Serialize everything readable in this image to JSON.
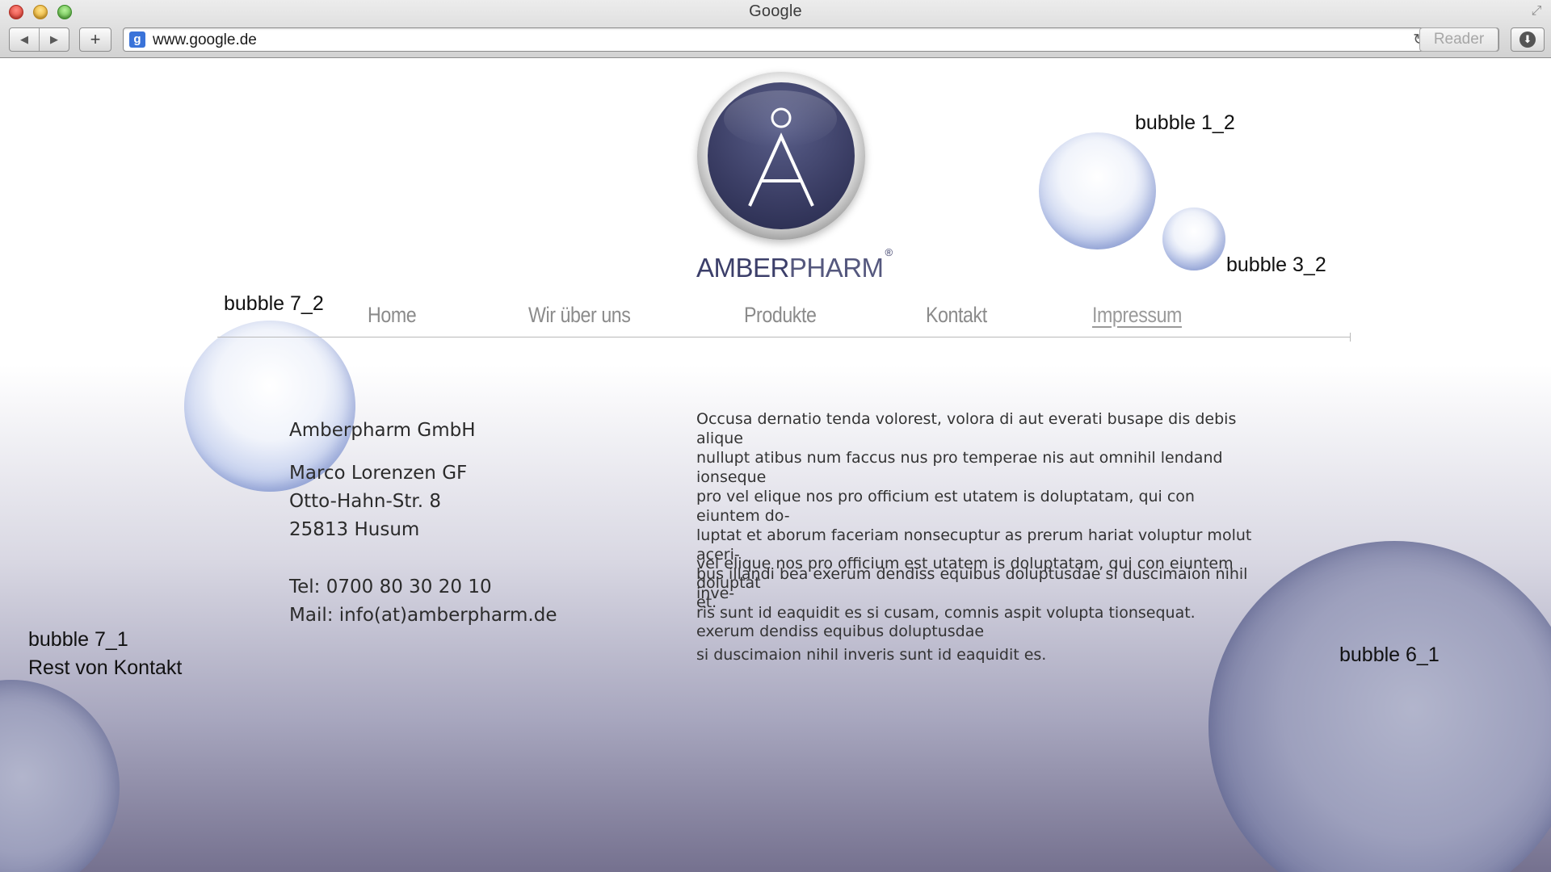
{
  "browser": {
    "window_title": "Google",
    "url": "www.google.de",
    "favicon_letter": "g",
    "reader_label": "Reader"
  },
  "logo": {
    "letter": "Å",
    "brand_bold": "AMBER",
    "brand_light": "PHARM",
    "registered": "®"
  },
  "nav": {
    "items": [
      {
        "label": "Home"
      },
      {
        "label": "Wir über uns"
      },
      {
        "label": "Produkte"
      },
      {
        "label": "Kontakt"
      },
      {
        "label": "Impressum",
        "active": true
      }
    ]
  },
  "annotations": {
    "bubble_1_2": "bubble 1_2",
    "bubble_3_2": "bubble 3_2",
    "bubble_7_2": "bubble 7_2",
    "bubble_7_1": "bubble 7_1",
    "rest_von_kontakt": "Rest von Kontakt",
    "bubble_6_1": "bubble 6_1"
  },
  "contact": {
    "company": "Amberpharm GmbH",
    "person": "Marco Lorenzen GF",
    "street": "Otto-Hahn-Str. 8",
    "city": "25813 Husum",
    "tel": "Tel: 0700 80 30 20 10",
    "mail": "Mail:  info(at)amberpharm.de"
  },
  "content": {
    "paragraph1": [
      "Occusa dernatio tenda volorest, volora di aut everati busape dis debis alique",
      "nullupt atibus num faccus nus pro temperae nis aut omnihil lendand ionseque",
      "pro vel elique nos pro officium est utatem is doluptatam, qui con eiuntem do-",
      "luptat et aborum faceriam nonsecuptur as prerum hariat voluptur molut aceri-",
      "bus illandi bea exerum dendiss equibus doluptusdae si duscimaion nihil inve-",
      "ris sunt id eaquidit es si cusam, comnis aspit volupta tionsequat."
    ],
    "paragraph2": [
      "vel elique nos pro officium est utatem is doluptatam, qui con eiuntem doluptat",
      "et."
    ],
    "paragraph3": [
      "exerum dendiss equibus doluptusdae",
      "si duscimaion nihil inveris sunt id eaquidit es."
    ]
  },
  "colors": {
    "brand": "#3c3f6a",
    "nav_text": "#8b8b8b",
    "page_gradient_bottom": "#75718f"
  }
}
